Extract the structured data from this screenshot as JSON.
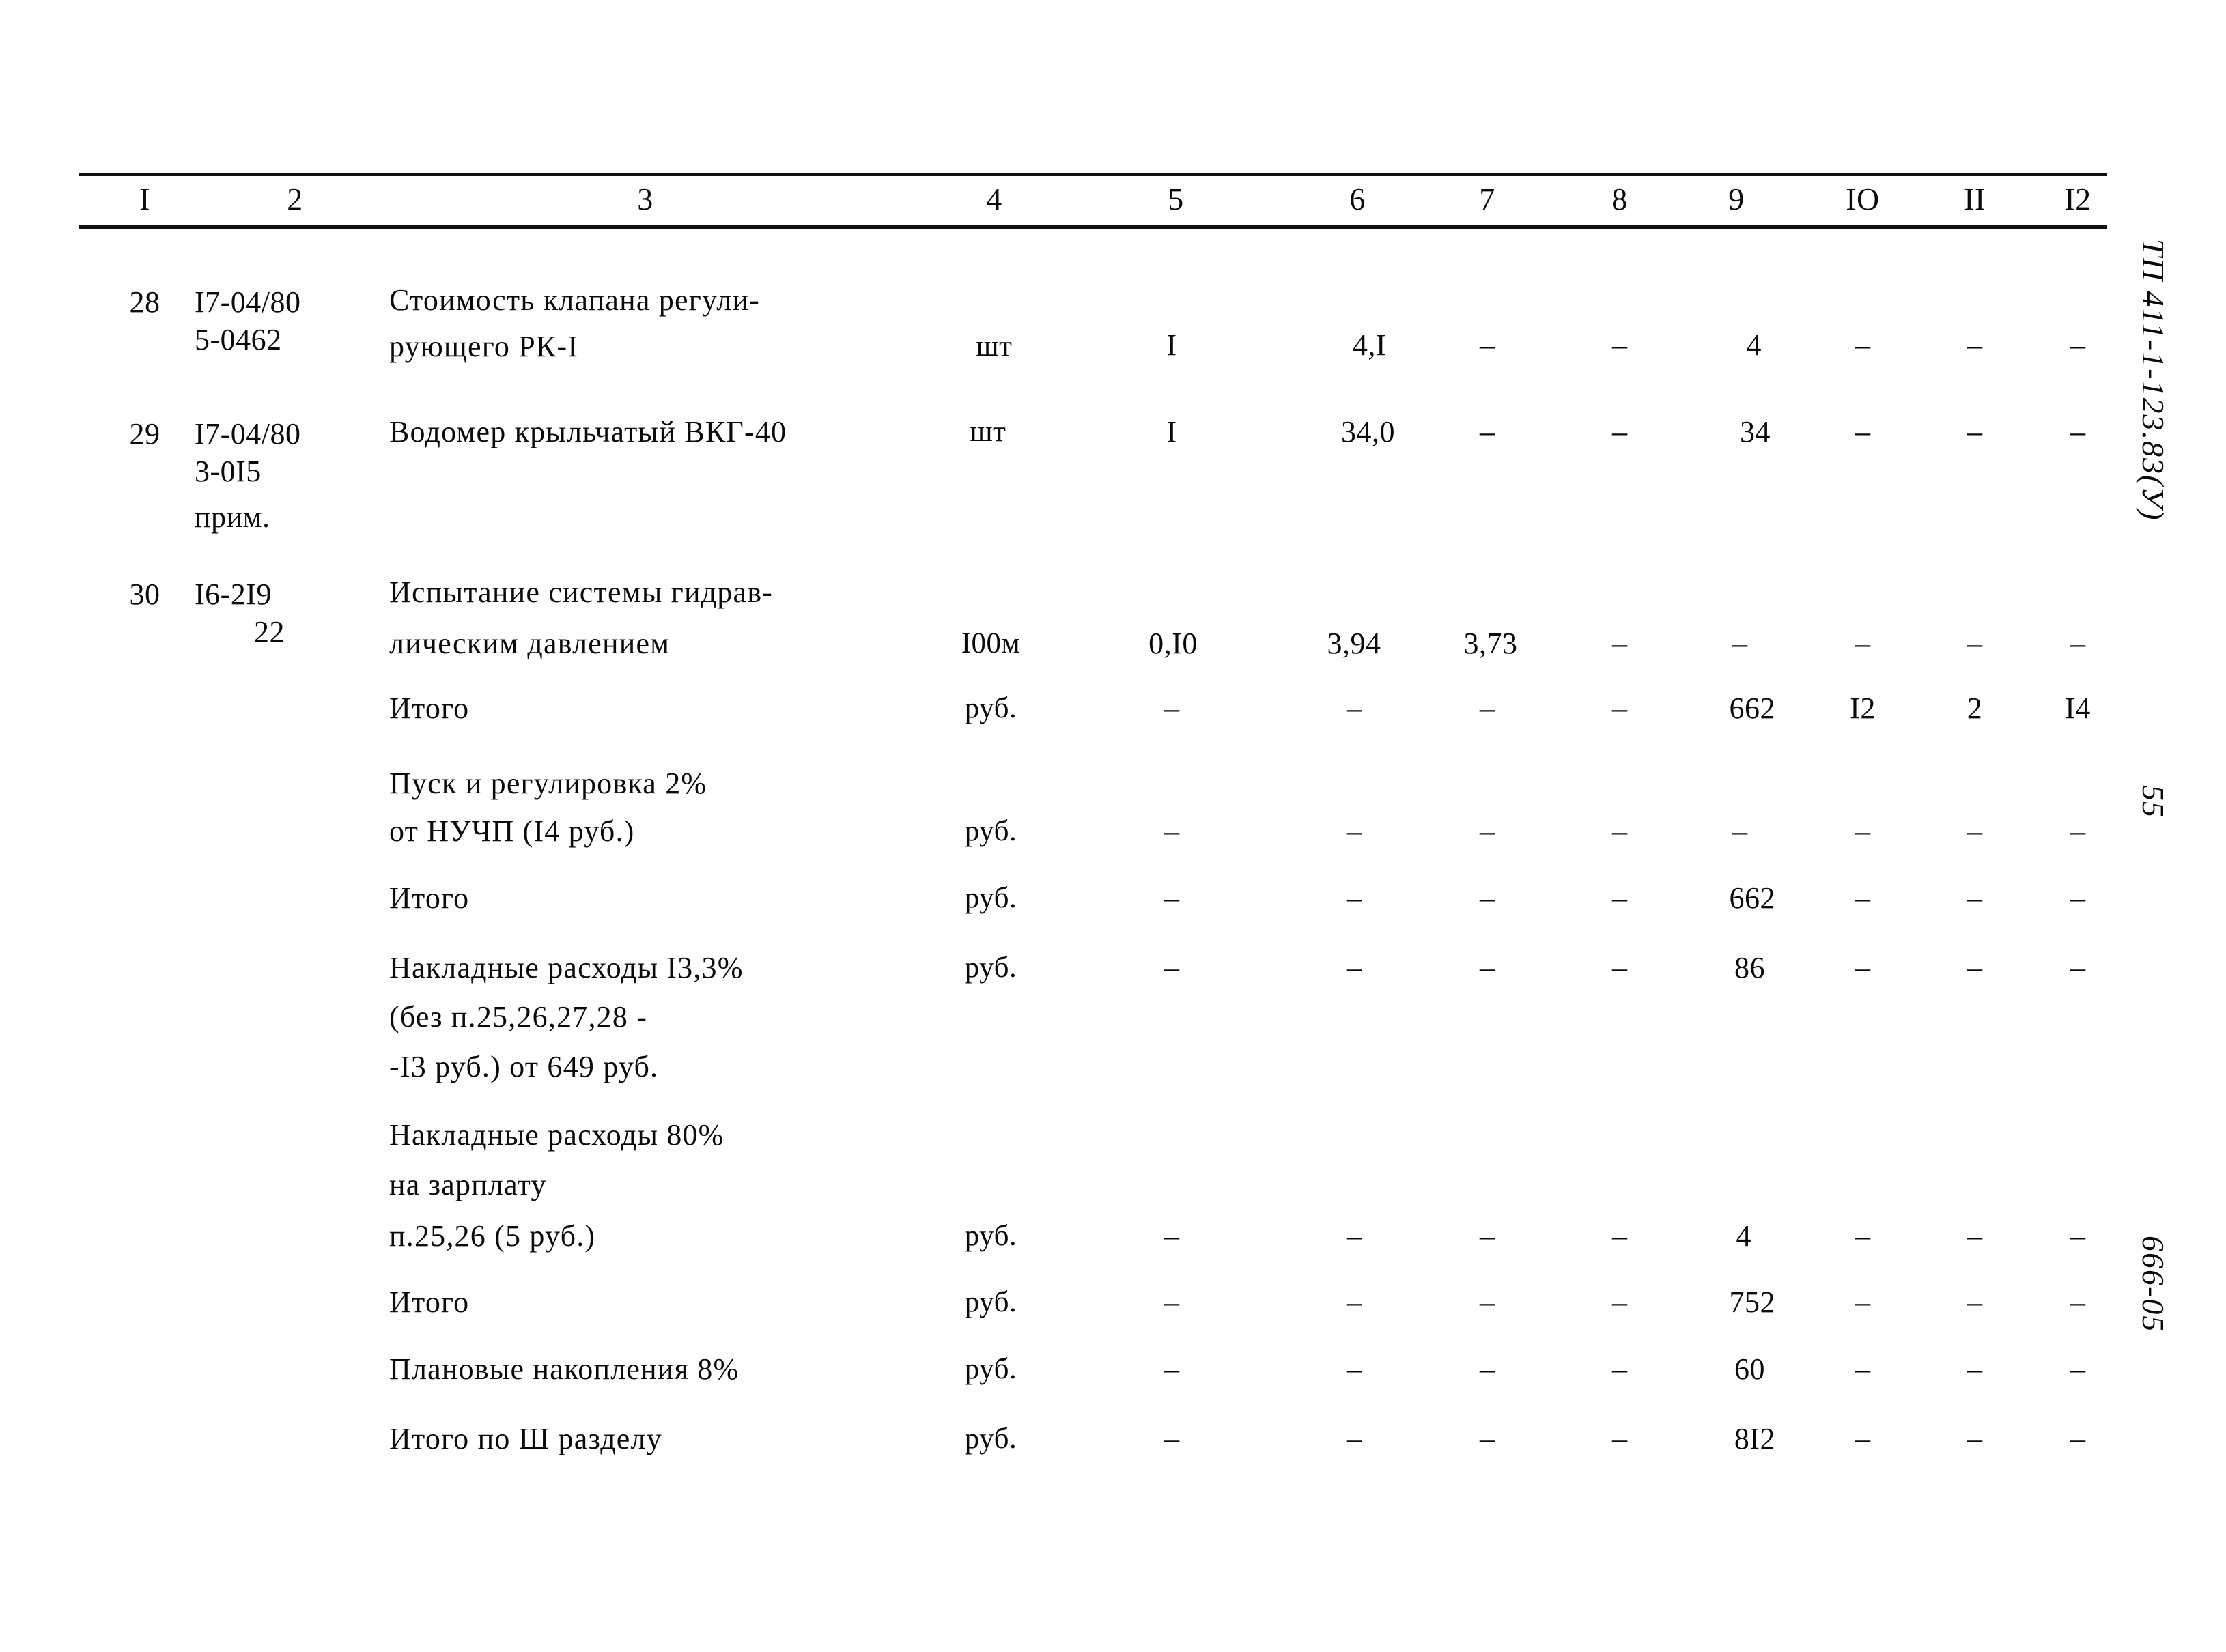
{
  "document": {
    "type": "construction-estimate-table",
    "page_number": "55",
    "project_code": "ТП 411-1-123.83(У)",
    "sheet_code": "666-05"
  },
  "table": {
    "column_headers": [
      "I",
      "2",
      "3",
      "4",
      "5",
      "6",
      "7",
      "8",
      "9",
      "IO",
      "II",
      "I2"
    ],
    "rows": [
      {
        "no": "28",
        "code_line1": "I7-04/80",
        "code_line2": "5-0462",
        "code_line3": "",
        "desc_line1": "Стоимость клапана регули-",
        "desc_line2": "рующего РК-I",
        "desc_line3": "",
        "c4": "шт",
        "c5": "I",
        "c6": "4,I",
        "c7": "–",
        "c8": "–",
        "c9": "4",
        "c10": "–",
        "c11": "–",
        "c12": "–"
      },
      {
        "no": "29",
        "code_line1": "I7-04/80",
        "code_line2": "3-0I5",
        "code_line3": "прим.",
        "desc_line1": "Водомер крыльчатый ВКГ-40",
        "desc_line2": "",
        "desc_line3": "",
        "c4": "шт",
        "c5": "I",
        "c6": "34,0",
        "c7": "–",
        "c8": "–",
        "c9": "34",
        "c10": "–",
        "c11": "–",
        "c12": "–"
      },
      {
        "no": "30",
        "code_line1": "I6-2I9",
        "code_line2": "22",
        "code_line3": "",
        "desc_line1": "Испытание системы гидрав-",
        "desc_line2": "лическим давлением",
        "desc_line3": "",
        "c4": "I00м",
        "c5": "0,I0",
        "c6": "3,94",
        "c7": "3,73",
        "c8": "–",
        "c9": "–",
        "c10": "–",
        "c11": "–",
        "c12": "–"
      },
      {
        "no": "",
        "code_line1": "",
        "code_line2": "",
        "code_line3": "",
        "desc_line1": "Итого",
        "desc_line2": "",
        "desc_line3": "",
        "c4": "руб.",
        "c5": "–",
        "c6": "–",
        "c7": "–",
        "c8": "–",
        "c9": "662",
        "c10": "I2",
        "c11": "2",
        "c12": "I4"
      },
      {
        "no": "",
        "code_line1": "",
        "code_line2": "",
        "code_line3": "",
        "desc_line1": "Пуск и регулировка 2%",
        "desc_line2": "от НУЧП (I4 руб.)",
        "desc_line3": "",
        "c4": "руб.",
        "c5": "–",
        "c6": "–",
        "c7": "–",
        "c8": "–",
        "c9": "–",
        "c10": "–",
        "c11": "–",
        "c12": "–"
      },
      {
        "no": "",
        "code_line1": "",
        "code_line2": "",
        "code_line3": "",
        "desc_line1": "Итого",
        "desc_line2": "",
        "desc_line3": "",
        "c4": "руб.",
        "c5": "–",
        "c6": "–",
        "c7": "–",
        "c8": "–",
        "c9": "662",
        "c10": "–",
        "c11": "–",
        "c12": "–"
      },
      {
        "no": "",
        "code_line1": "",
        "code_line2": "",
        "code_line3": "",
        "desc_line1": "Накладные расходы I3,3%",
        "desc_line2": "(без п.25,26,27,28 -",
        "desc_line3": "-I3 руб.) от 649 руб.",
        "c4": "руб.",
        "c5": "–",
        "c6": "–",
        "c7": "–",
        "c8": "–",
        "c9": "86",
        "c10": "–",
        "c11": "–",
        "c12": "–"
      },
      {
        "no": "",
        "code_line1": "",
        "code_line2": "",
        "code_line3": "",
        "desc_line1": "Накладные расходы 80%",
        "desc_line2": "на зарплату",
        "desc_line3": "п.25,26 (5 руб.)",
        "c4": "руб.",
        "c5": "–",
        "c6": "–",
        "c7": "–",
        "c8": "–",
        "c9": "4",
        "c10": "–",
        "c11": "–",
        "c12": "–"
      },
      {
        "no": "",
        "code_line1": "",
        "code_line2": "",
        "code_line3": "",
        "desc_line1": "Итого",
        "desc_line2": "",
        "desc_line3": "",
        "c4": "руб.",
        "c5": "–",
        "c6": "–",
        "c7": "–",
        "c8": "–",
        "c9": "752",
        "c10": "–",
        "c11": "–",
        "c12": "–"
      },
      {
        "no": "",
        "code_line1": "",
        "code_line2": "",
        "code_line3": "",
        "desc_line1": "Плановые накопления 8%",
        "desc_line2": "",
        "desc_line3": "",
        "c4": "руб.",
        "c5": "–",
        "c6": "–",
        "c7": "–",
        "c8": "–",
        "c9": "60",
        "c10": "–",
        "c11": "–",
        "c12": "–"
      },
      {
        "no": "",
        "code_line1": "",
        "code_line2": "",
        "code_line3": "",
        "desc_line1": "Итого по Ш разделу",
        "desc_line2": "",
        "desc_line3": "",
        "c4": "руб.",
        "c5": "–",
        "c6": "–",
        "c7": "–",
        "c8": "–",
        "c9": "8I2",
        "c10": "–",
        "c11": "–",
        "c12": "–"
      }
    ]
  }
}
